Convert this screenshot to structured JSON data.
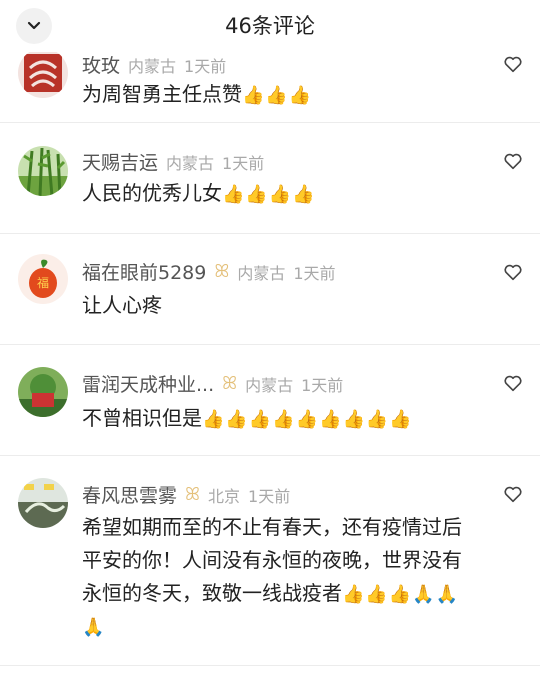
{
  "header": {
    "title": "46条评论",
    "collapse_icon": "chevron-down-icon"
  },
  "comments": [
    {
      "name": "玫玫",
      "location": "内蒙古",
      "time": "1天前",
      "badge": "",
      "text": "为周智勇主任点赞",
      "emoji": "👍👍👍"
    },
    {
      "name": "天赐吉运",
      "location": "内蒙古",
      "time": "1天前",
      "badge": "",
      "text": "人民的优秀儿女",
      "emoji": "👍👍👍👍"
    },
    {
      "name": "福在眼前5289",
      "location": "内蒙古",
      "time": "1天前",
      "badge": "ꕤ",
      "text": "让人心疼",
      "emoji": ""
    },
    {
      "name": "雷润天成种业...",
      "location": "内蒙古",
      "time": "1天前",
      "badge": "ꕤ",
      "text": "不曾相识但是",
      "emoji": "👍👍👍👍👍👍👍👍👍"
    },
    {
      "name": "春风思雲雾",
      "location": "北京",
      "time": "1天前",
      "badge": "ꕤ",
      "text_lines": [
        "希望如期而至的不止有春天，还有疫情过后",
        "平安的你！人间没有永恒的夜晚，世界没有",
        "永恒的冬天，致敬一线战疫者"
      ],
      "emoji": "👍👍👍🙏🙏",
      "emoji_tail": "🙏"
    }
  ],
  "icons": {
    "heart": "heart-outline-icon"
  }
}
